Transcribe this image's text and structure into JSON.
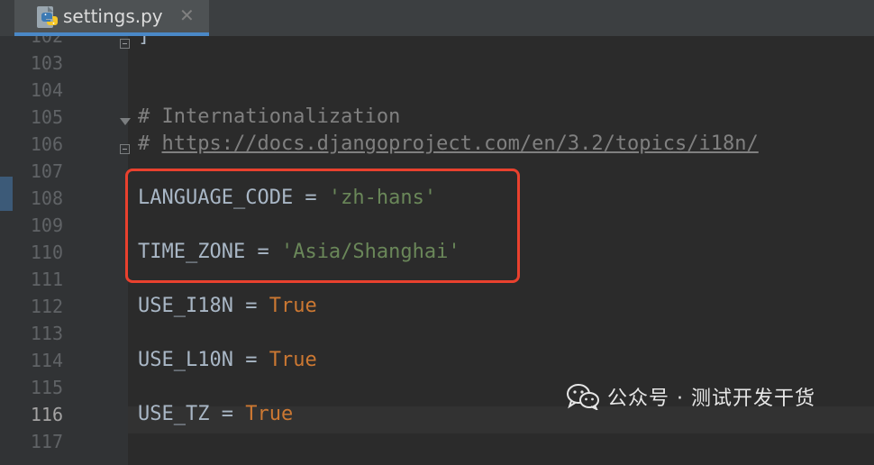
{
  "tab": {
    "title": "settings.py",
    "close_symbol": "✕",
    "icon": "python-file-icon"
  },
  "editor": {
    "lines": [
      {
        "number": "102",
        "segments": [
          {
            "type": "plain",
            "text": "]"
          }
        ]
      },
      {
        "number": "103",
        "segments": []
      },
      {
        "number": "104",
        "segments": []
      },
      {
        "number": "105",
        "segments": [
          {
            "type": "comment",
            "text": "# Internationalization"
          }
        ]
      },
      {
        "number": "106",
        "segments": [
          {
            "type": "comment",
            "text": "# "
          },
          {
            "type": "link",
            "text": "https://docs.djangoproject.com/en/3.2/topics/i18n/"
          }
        ]
      },
      {
        "number": "107",
        "segments": []
      },
      {
        "number": "108",
        "segments": [
          {
            "type": "plain",
            "text": "LANGUAGE_CODE = "
          },
          {
            "type": "string",
            "text": "'zh-hans'"
          }
        ]
      },
      {
        "number": "109",
        "segments": []
      },
      {
        "number": "110",
        "segments": [
          {
            "type": "plain",
            "text": "TIME_ZONE = "
          },
          {
            "type": "string",
            "text": "'Asia/Shanghai'"
          }
        ]
      },
      {
        "number": "111",
        "segments": []
      },
      {
        "number": "112",
        "segments": [
          {
            "type": "plain",
            "text": "USE_I18N = "
          },
          {
            "type": "keyword",
            "text": "True"
          }
        ]
      },
      {
        "number": "113",
        "segments": []
      },
      {
        "number": "114",
        "segments": [
          {
            "type": "plain",
            "text": "USE_L10N = "
          },
          {
            "type": "keyword",
            "text": "True"
          }
        ]
      },
      {
        "number": "115",
        "segments": []
      },
      {
        "number": "116",
        "segments": [
          {
            "type": "plain",
            "text": "USE_TZ = "
          },
          {
            "type": "keyword",
            "text": "True"
          }
        ]
      },
      {
        "number": "117",
        "segments": []
      }
    ],
    "current_line": "116",
    "highlighted_lines": [
      "108",
      "110"
    ]
  },
  "watermark": {
    "text": "公众号 · 测试开发干货",
    "icon": "wechat-icon"
  },
  "colors": {
    "background": "#2b2b2b",
    "gutter": "#313335",
    "comment": "#808080",
    "string": "#6a8759",
    "keyword": "#cc7832",
    "plain": "#a9b7c6",
    "highlight_box": "#e9412e",
    "tab_underline": "#4a88c7"
  }
}
